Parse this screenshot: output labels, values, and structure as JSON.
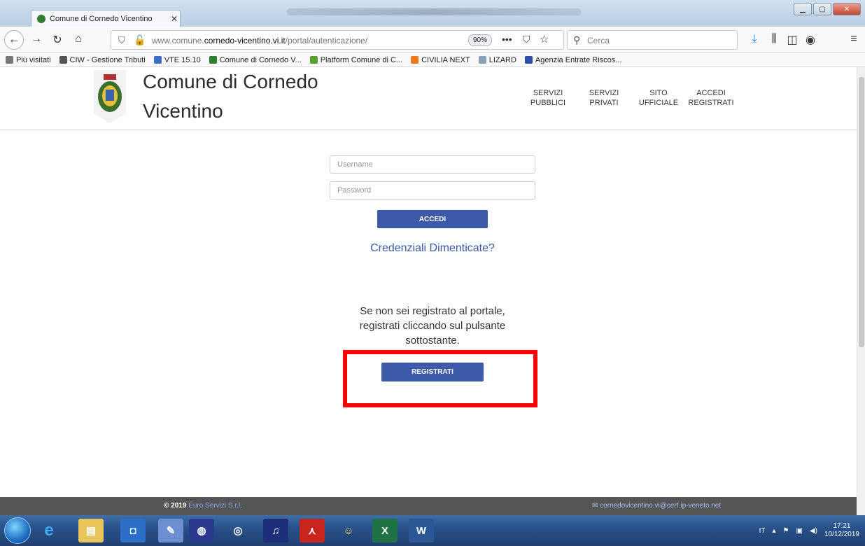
{
  "browser": {
    "tab_title": "Comune di Cornedo Vicentino",
    "tab_close": "✕",
    "url_prefix": "www.comune.",
    "url_domain": "cornedo-vicentino.vi.it",
    "url_path": "/portal/autenticazione/",
    "zoom": "90%",
    "search_placeholder": "Cerca"
  },
  "bookmarks": [
    {
      "label": "Più visitati",
      "color": "#777777"
    },
    {
      "label": "CIW - Gestione Tributi",
      "color": "#555555"
    },
    {
      "label": "VTE 15.10",
      "color": "#3a6fc4"
    },
    {
      "label": "Comune di Cornedo V...",
      "color": "#2f7d32"
    },
    {
      "label": "Platform Comune di C...",
      "color": "#5aa02c"
    },
    {
      "label": "CIVILIA NEXT",
      "color": "#f07a1a"
    },
    {
      "label": "LIZARD",
      "color": "#8aa0b8"
    },
    {
      "label": "Agenzia Entrate Riscos...",
      "color": "#2a4fa8"
    }
  ],
  "site": {
    "title_line1": "Comune di Cornedo",
    "title_line2": "Vicentino",
    "nav": [
      {
        "line1": "SERVIZI",
        "line2": "PUBBLICI"
      },
      {
        "line1": "SERVIZI",
        "line2": "PRIVATI"
      },
      {
        "line1": "SITO",
        "line2": "UFFICIALE"
      },
      {
        "line1": "ACCEDI",
        "line2": "REGISTRATI"
      }
    ]
  },
  "login": {
    "username_placeholder": "Username",
    "password_placeholder": "Password",
    "login_button": "ACCEDI",
    "forgot_link": "Credenziali Dimenticate?"
  },
  "register": {
    "text_line1": "Se non sei registrato al portale,",
    "text_line2": "registrati cliccando sul pulsante",
    "text_line3": "sottostante.",
    "button": "REGISTRATI"
  },
  "footer": {
    "copyright": "© 2019",
    "company": "Euro Servizi S.r.l.",
    "email": "cornedovicentino.vi@cert.ip-veneto.net"
  },
  "taskbar": {
    "language": "IT",
    "time": "17:21",
    "date": "10/12/2019"
  },
  "colors": {
    "primary_button": "#3d5aa8",
    "link": "#3a5aa4",
    "footer_bg": "#555555",
    "highlight": "#ff0000"
  }
}
